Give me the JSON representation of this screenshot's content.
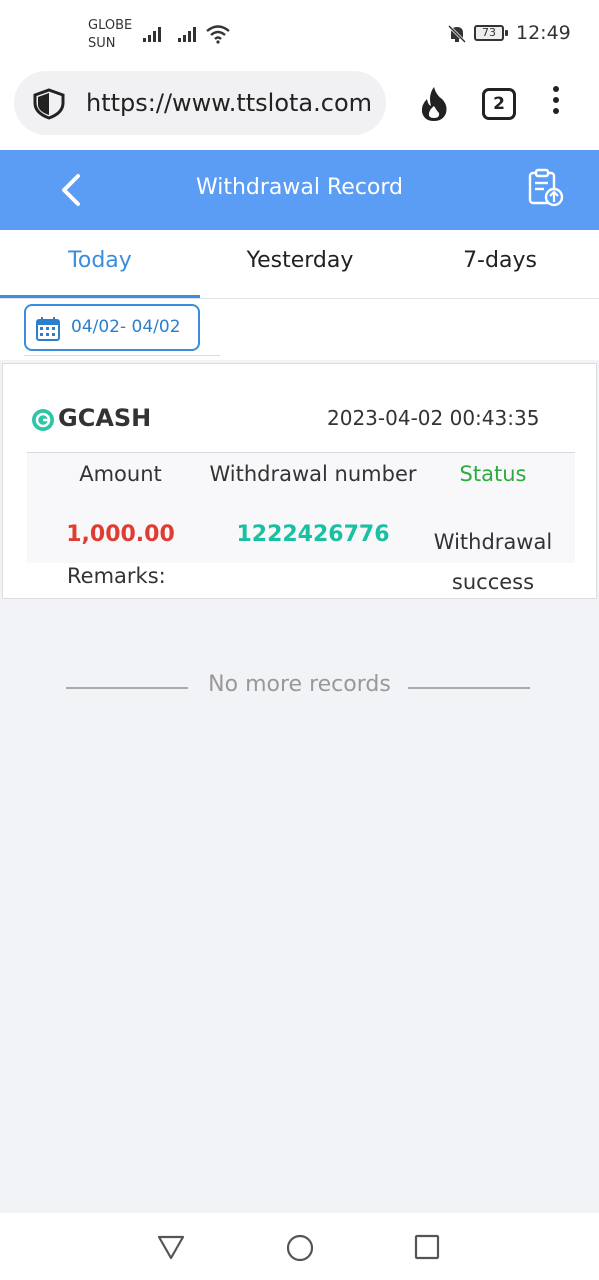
{
  "status_bar": {
    "carrier_1": "GLOBE",
    "carrier_2": "SUN",
    "battery": "73",
    "time": "12:49",
    "icons": [
      "signal-icon",
      "signal-icon",
      "wifi-icon",
      "bell-off-icon",
      "battery-icon"
    ]
  },
  "browser": {
    "url": "https://www.ttslota.com",
    "tab_count": "2",
    "icons": [
      "shield-icon",
      "flame-icon",
      "more-vert-icon"
    ]
  },
  "header": {
    "title": "Withdrawal Record",
    "icons": [
      "back-arrow-icon",
      "export-record-icon"
    ],
    "background_color": "#5b9cf4"
  },
  "tabs": [
    {
      "label": "Today",
      "active": true
    },
    {
      "label": "Yesterday",
      "active": false
    },
    {
      "label": "7-days",
      "active": false
    }
  ],
  "date_filter": {
    "range": "04/02- 04/02",
    "icon": "calendar-icon"
  },
  "records": [
    {
      "method": "GCASH",
      "datetime": "2023-04-02 00:43:35",
      "labels": {
        "amount": "Amount",
        "withdrawal_number": "Withdrawal number",
        "status": "Status",
        "remarks": "Remarks:"
      },
      "amount": "1,000.00",
      "withdrawal_number": "1222426776",
      "status": "Withdrawal success"
    }
  ],
  "footer_text": "No more records",
  "colors": {
    "accent": "#3a8ddf",
    "amount": "#e03d32",
    "withdrawal_number": "#19c0a2",
    "status_label": "#2eaa3e"
  }
}
